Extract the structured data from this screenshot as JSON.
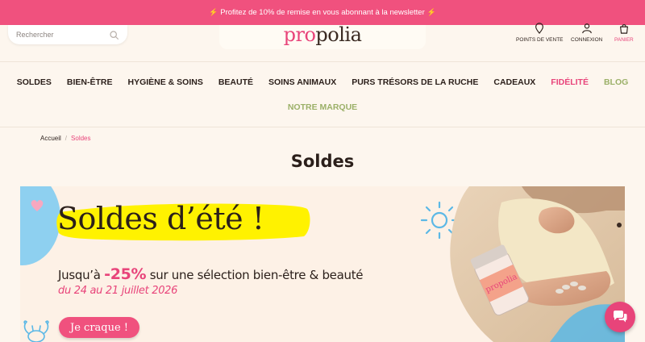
{
  "promo": {
    "text": "Profitez de 10% de remise en vous abonnant à la newsletter",
    "bolt": "⚡"
  },
  "search": {
    "placeholder": "Rechercher",
    "icon": "search-icon"
  },
  "logo": {
    "pre": "pro",
    "post": "polia"
  },
  "header_links": [
    {
      "label": "POINTS DE VENTE",
      "icon": "location-pin-icon"
    },
    {
      "label": "CONNEXION",
      "icon": "user-icon"
    },
    {
      "label": "PANIER",
      "icon": "bag-icon"
    }
  ],
  "nav": {
    "items": [
      {
        "label": "SOLDES"
      },
      {
        "label": "BIEN-ÊTRE"
      },
      {
        "label": "HYGIÈNE & SOINS"
      },
      {
        "label": "BEAUTÉ"
      },
      {
        "label": "SOINS ANIMAUX"
      },
      {
        "label": "PURS TRÉSORS DE LA RUCHE"
      },
      {
        "label": "CADEAUX"
      },
      {
        "label": "FIDÉLITÉ"
      },
      {
        "label": "BLOG"
      },
      {
        "label": "NOTRE MARQUE"
      }
    ]
  },
  "breadcrumb": {
    "home": "Accueil",
    "separator": "/",
    "current": "Soldes"
  },
  "page": {
    "title": "Soldes"
  },
  "banner": {
    "headline": "Soldes d’été !",
    "sub_prefix": "Jusqu’à",
    "sub_percent": "-25%",
    "sub_suffix": "sur une sélection bien-être & beauté",
    "dates": "du 24 au 21 juillet 2026",
    "cta": "Je craque !"
  },
  "colors": {
    "accent": "#e8447a",
    "promo_bar": "#f0517e",
    "highlight": "#fff200",
    "green": "#9bb068",
    "background": "#fdf6ee"
  },
  "chat": {
    "icon": "chat-bubbles-icon"
  }
}
